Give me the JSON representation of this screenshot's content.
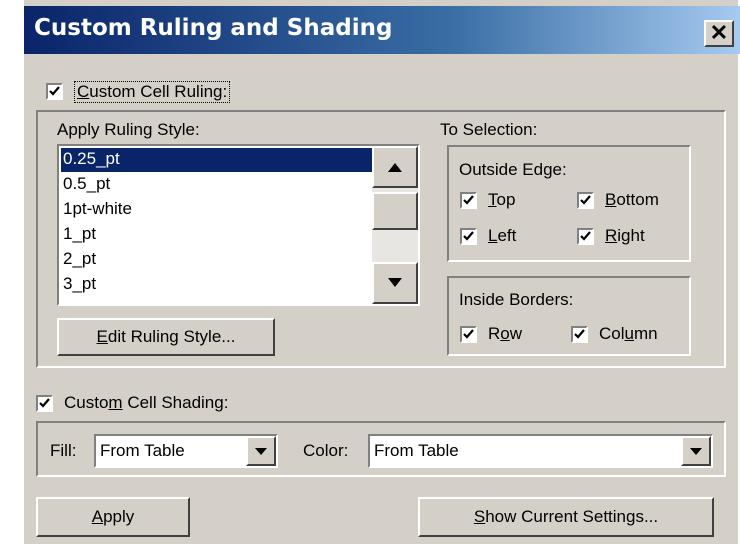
{
  "window": {
    "title": "Custom Ruling and Shading",
    "close_glyph": "✕"
  },
  "ruling": {
    "checkbox_label_pre": "",
    "checkbox_label_u": "C",
    "checkbox_label_post": "ustom Cell Ruling:",
    "checked": true,
    "apply_style_label": "Apply Ruling Style:",
    "styles": [
      "0.25_pt",
      "0.5_pt",
      "1pt-white",
      "1_pt",
      "2_pt",
      "3_pt"
    ],
    "selected_style": "0.25_pt",
    "edit_button": {
      "u": "E",
      "rest": "dit Ruling Style..."
    },
    "to_selection_label": "To Selection:",
    "outside_edge": {
      "label": "Outside Edge:",
      "top": {
        "u": "T",
        "rest": "op",
        "checked": true
      },
      "bottom": {
        "u": "B",
        "rest": "ottom",
        "checked": true
      },
      "left": {
        "u": "L",
        "rest": "eft",
        "checked": true
      },
      "right": {
        "u": "R",
        "rest": "ight",
        "checked": true
      }
    },
    "inside_borders": {
      "label": "Inside Borders:",
      "row": {
        "pre": "R",
        "u": "o",
        "post": "w",
        "checked": true
      },
      "column": {
        "pre": "Col",
        "u": "u",
        "post": "mn",
        "checked": true
      }
    }
  },
  "shading": {
    "checkbox_pre": "Custo",
    "checkbox_u": "m",
    "checkbox_post": " Cell Shading:",
    "checked": true,
    "fill_label": "Fill:",
    "fill_value": "From Table",
    "color_label": "Color:",
    "color_value": "From Table"
  },
  "buttons": {
    "apply": {
      "u": "A",
      "rest": "pply"
    },
    "show": {
      "u": "S",
      "rest": "how Current Settings..."
    }
  },
  "colors": {
    "title_bar": "#0a246a",
    "selection": "#0a246a",
    "face": "#d4d0c8"
  }
}
